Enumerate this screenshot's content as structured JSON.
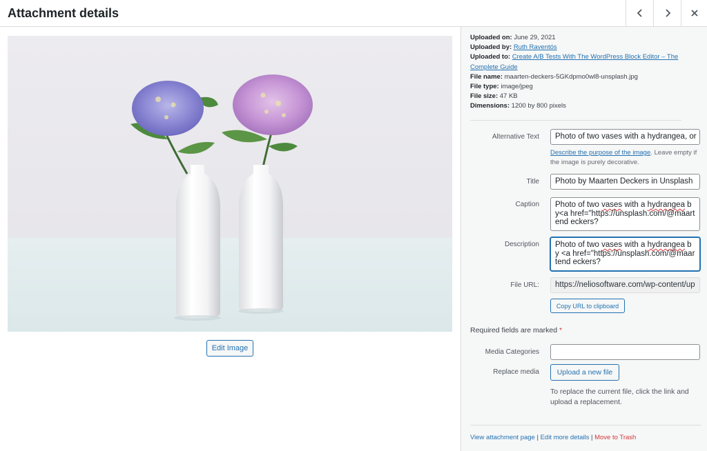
{
  "header": {
    "title": "Attachment details",
    "prev_icon": "chevron-left-icon",
    "next_icon": "chevron-right-icon",
    "close_icon": "close-icon"
  },
  "preview": {
    "edit_image_label": "Edit Image"
  },
  "details": {
    "uploaded_on_label": "Uploaded on:",
    "uploaded_on_value": "June 29, 2021",
    "uploaded_by_label": "Uploaded by:",
    "uploaded_by_value": "Ruth Raventós",
    "uploaded_to_label": "Uploaded to:",
    "uploaded_to_value": "Create A/B Tests With The WordPress Block Editor – The Complete Guide",
    "file_name_label": "File name:",
    "file_name_value": "maarten-deckers-5GKdpmo0wl8-unsplash.jpg",
    "file_type_label": "File type:",
    "file_type_value": "image/jpeg",
    "file_size_label": "File size:",
    "file_size_value": "47 KB",
    "dimensions_label": "Dimensions:",
    "dimensions_value": "1200 by 800 pixels"
  },
  "form": {
    "alt_label": "Alternative Text",
    "alt_value": "Photo of two vases with a hydrangea, or",
    "alt_help_link": "Describe the purpose of the image",
    "alt_help_text": ". Leave empty if the image is purely decorative.",
    "title_label": "Title",
    "title_value": "Photo by Maarten Deckers in Unsplash",
    "caption_label": "Caption",
    "caption_value_a": "Photo of two ",
    "caption_value_b": "vases",
    "caption_value_c": " with a ",
    "caption_value_d": "hydrangea",
    "caption_value_e": " by<a href=\"https://unsplash.com/@maartend eckers?",
    "description_label": "Description",
    "description_value_a": "Photo of two ",
    "description_value_b": "vases",
    "description_value_c": " with a ",
    "description_value_d": "hydrangea",
    "description_value_e": " by <a href=\"https://unsplash.com/@maartend eckers?",
    "file_url_label": "File URL:",
    "file_url_value": "https://neliosoftware.com/wp-content/up",
    "copy_url_label": "Copy URL to clipboard",
    "required_text": "Required fields are marked ",
    "required_star": "*",
    "media_categories_label": "Media Categories",
    "media_categories_value": "",
    "replace_media_label": "Replace media",
    "upload_new_file_label": "Upload a new file",
    "replace_help": "To replace the current file, click the link and upload a replacement."
  },
  "actions": {
    "view_attachment": "View attachment page",
    "sep1": " | ",
    "edit_more": "Edit more details",
    "sep2": " | ",
    "move_to_trash": "Move to Trash"
  },
  "colors": {
    "accent": "#2271b1",
    "danger": "#d63638",
    "sidebar_bg": "#f6f7f7"
  }
}
